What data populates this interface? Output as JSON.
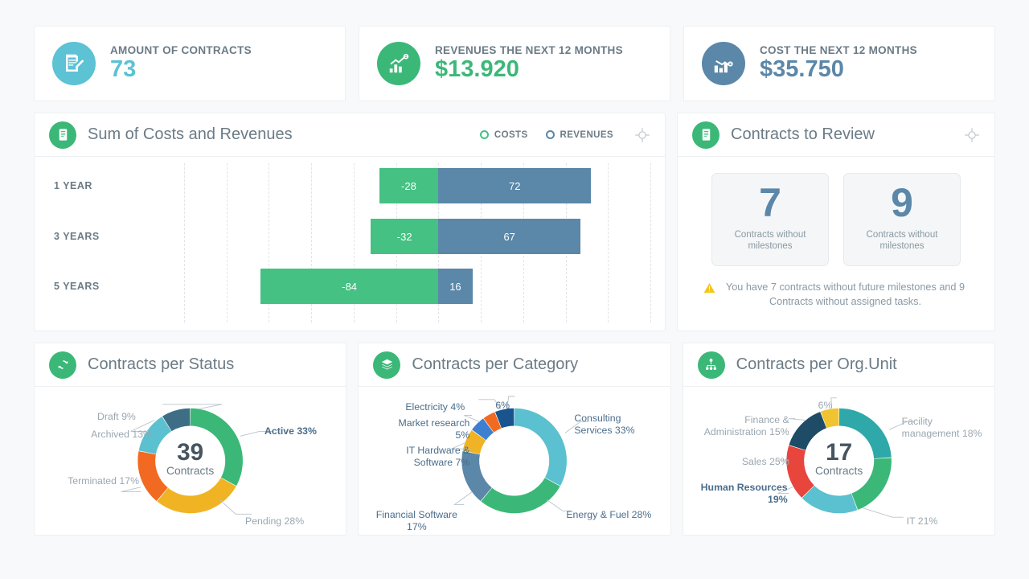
{
  "theme": {
    "bg": "#f7f9fa",
    "green": "#3bb878",
    "teal": "#5bc0cf",
    "steel": "#5b87a8",
    "bar_neg": "#45c183",
    "bar_pos": "#5b87a8",
    "muted": "#9aa7b0"
  },
  "kpis": [
    {
      "label": "AMOUNT OF CONTRACTS",
      "value": "73",
      "icon": "document-edit-icon",
      "circle_color": "#5cc2d4",
      "value_color": "#5cc2d4"
    },
    {
      "label": "REVENUES THE NEXT 12 MONTHS",
      "value": "$13.920",
      "icon": "revenue-chart-icon",
      "circle_color": "#3bb878",
      "value_color": "#3bb878"
    },
    {
      "label": "COST THE NEXT 12  MONTHS",
      "value": "$35.750",
      "icon": "cost-chart-icon",
      "circle_color": "#5b87a8",
      "value_color": "#5b87a8"
    }
  ],
  "costs_revenues": {
    "title": "Sum of Costs and Revenues",
    "icon": "document-list-icon",
    "target_icon": "target-icon",
    "legend": [
      {
        "label": "COSTS",
        "color": "#45c183"
      },
      {
        "label": "REVENUES",
        "color": "#5b87a8"
      }
    ],
    "chart_data": {
      "type": "bar",
      "orientation": "horizontal",
      "stacked": "diverging",
      "title": "Sum of Costs and Revenues",
      "categories": [
        "1 YEAR",
        "3 YEARS",
        "5 YEARS"
      ],
      "series": [
        {
          "name": "COSTS",
          "color": "#45c183",
          "values": [
            -28,
            -32,
            -84
          ]
        },
        {
          "name": "REVENUES",
          "color": "#5b87a8",
          "values": [
            72,
            67,
            16
          ]
        }
      ],
      "xlim": [
        -120,
        100
      ],
      "grid": true,
      "legend_position": "top-right"
    }
  },
  "review": {
    "title": "Contracts to Review",
    "icon": "document-list-icon",
    "target_icon": "target-icon",
    "tiles": [
      {
        "value": "7",
        "label": "Contracts without milestones"
      },
      {
        "value": "9",
        "label": "Contracts without milestones"
      }
    ],
    "warning_icon": "warning-triangle-icon",
    "warning_text": "You have 7 contracts without future milestones and 9 Contracts without assigned tasks."
  },
  "status": {
    "title": "Contracts per Status",
    "icon": "refresh-cycle-icon",
    "chart_data": {
      "type": "pie",
      "variant": "donut",
      "title": "Contracts per Status",
      "center_value": "39",
      "center_label": "Contracts",
      "labels": [
        "Active",
        "Pending",
        "Terminated",
        "Archived",
        "Draft"
      ],
      "values": [
        33,
        28,
        17,
        13,
        9
      ],
      "unit": "%",
      "colors": [
        "#3bb878",
        "#f0b323",
        "#f26a21",
        "#5bc0cf",
        "#3e6e86"
      ],
      "annotations": [
        {
          "text": "Active 33%",
          "emphasis": true
        },
        {
          "text": "Pending 28%",
          "emphasis": false
        },
        {
          "text": "Terminated 17%",
          "emphasis": false
        },
        {
          "text": "Archived 13%",
          "emphasis": false
        },
        {
          "text": "Draft 9%",
          "emphasis": false
        }
      ]
    }
  },
  "category": {
    "title": "Contracts per Category",
    "icon": "layers-icon",
    "chart_data": {
      "type": "pie",
      "variant": "donut",
      "title": "Contracts per Category",
      "center_value": "",
      "center_label": "",
      "labels": [
        "Consulting Services",
        "Energy & Fuel",
        "Financial Software",
        "IT Hardware & Software",
        "Market research",
        "Electricity",
        ""
      ],
      "values": [
        33,
        28,
        17,
        7,
        5,
        4,
        6
      ],
      "unit": "%",
      "colors": [
        "#5bc0cf",
        "#3bb878",
        "#5b87a8",
        "#f0b323",
        "#3f7fd0",
        "#f26a21",
        "#19548f"
      ],
      "annotations": [
        {
          "text": "Consulting Services 33%",
          "emphasis": true
        },
        {
          "text": "Energy & Fuel 28%",
          "emphasis": true
        },
        {
          "text": "Financial Software 17%",
          "emphasis": true
        },
        {
          "text": "IT Hardware & Software 7%",
          "emphasis": true
        },
        {
          "text": "Market research 5%",
          "emphasis": true
        },
        {
          "text": "Electricity 4%",
          "emphasis": true
        },
        {
          "text": "6%",
          "emphasis": true
        }
      ]
    }
  },
  "orgunit": {
    "title": "Contracts per Org.Unit",
    "icon": "hierarchy-icon",
    "chart_data": {
      "type": "pie",
      "variant": "donut",
      "title": "Contracts per Org.Unit",
      "center_value": "17",
      "center_label": "Contracts",
      "labels": [
        "Sales",
        "IT",
        "Human Resources",
        "Facility management",
        "Finance & Administration",
        ""
      ],
      "values": [
        25,
        21,
        19,
        18,
        15,
        6
      ],
      "unit": "%",
      "colors": [
        "#2ea8a8",
        "#3bb878",
        "#5bc0cf",
        "#e8453c",
        "#1e4c66",
        "#f0c330"
      ],
      "annotations": [
        {
          "text": "Facility management 18%",
          "emphasis": false
        },
        {
          "text": "IT 21%",
          "emphasis": false
        },
        {
          "text": "Human Resources 19%",
          "emphasis": true
        },
        {
          "text": "Sales 25%",
          "emphasis": false
        },
        {
          "text": "Finance & Administration 15%",
          "emphasis": false
        },
        {
          "text": "6%",
          "emphasis": false
        }
      ]
    }
  },
  "labels": {
    "status": {
      "draft": "Draft 9%",
      "archived": "Archived 13%",
      "terminated": "Terminated 17%",
      "pending": "Pending 28%",
      "active": "Active 33%"
    },
    "category": {
      "electricity": "Electricity 4%",
      "market": "Market research 5%",
      "ithw": "IT Hardware & Software 7%",
      "financial": "Financial Software 17%",
      "energy": "Energy & Fuel 28%",
      "consulting": "Consulting Services 33%",
      "six": "6%"
    },
    "orgunit": {
      "finance": "Finance & Administration 15%",
      "sales": "Sales 25%",
      "hr": "Human Resources 19%",
      "facility": "Facility management 18%",
      "it": "IT 21%",
      "six": "6%"
    }
  }
}
